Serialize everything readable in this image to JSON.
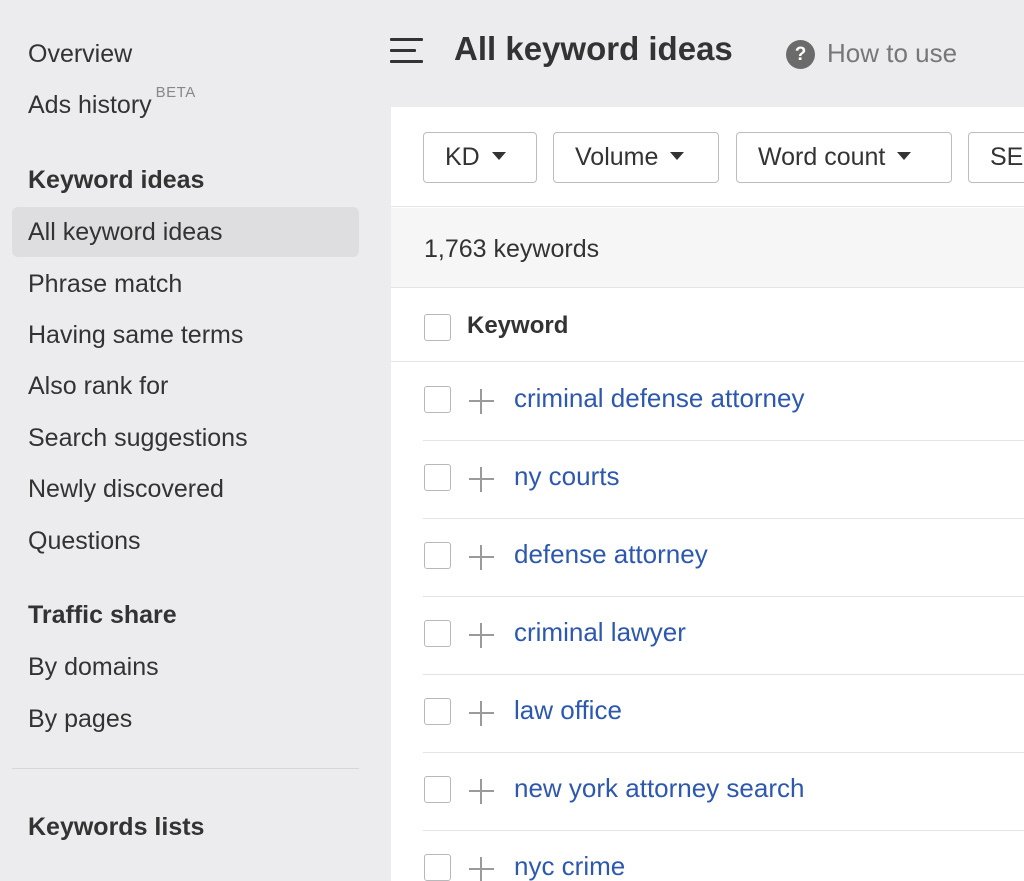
{
  "sidebar": {
    "overview": "Overview",
    "ads_history": "Ads history",
    "ads_history_badge": "BETA",
    "keyword_ideas_heading": "Keyword ideas",
    "keyword_ideas_items": [
      {
        "label": "All keyword ideas",
        "active": true
      },
      {
        "label": "Phrase match",
        "active": false
      },
      {
        "label": "Having same terms",
        "active": false
      },
      {
        "label": "Also rank for",
        "active": false
      },
      {
        "label": "Search suggestions",
        "active": false
      },
      {
        "label": "Newly discovered",
        "active": false
      },
      {
        "label": "Questions",
        "active": false
      }
    ],
    "traffic_share_heading": "Traffic share",
    "traffic_share_items": [
      {
        "label": "By domains"
      },
      {
        "label": "By pages"
      }
    ],
    "keywords_lists_heading": "Keywords lists"
  },
  "header": {
    "title": "All keyword ideas",
    "help_icon": "question-circle-icon",
    "how_to_use": "How to use"
  },
  "filters": [
    {
      "label": "KD"
    },
    {
      "label": "Volume"
    },
    {
      "label": "Word count"
    },
    {
      "label": "SE"
    }
  ],
  "results": {
    "count_text": "1,763 keywords",
    "column_keyword": "Keyword",
    "rows": [
      {
        "keyword": "criminal defense attorney"
      },
      {
        "keyword": "ny courts"
      },
      {
        "keyword": "defense attorney"
      },
      {
        "keyword": "criminal lawyer"
      },
      {
        "keyword": "law office"
      },
      {
        "keyword": "new york attorney search"
      },
      {
        "keyword": "nyc crime"
      }
    ]
  },
  "colors": {
    "link": "#2d58b0",
    "active_bg": "#dedee0",
    "page_bg": "#ececee"
  }
}
